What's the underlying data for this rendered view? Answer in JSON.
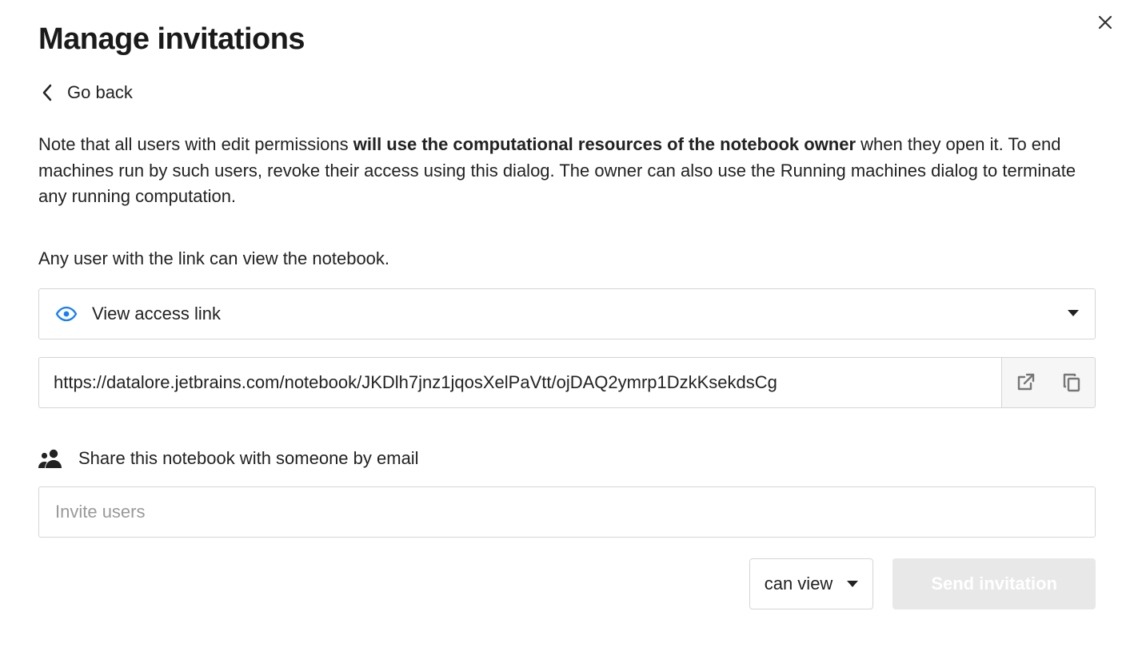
{
  "title": "Manage invitations",
  "go_back_label": "Go back",
  "note": {
    "prefix": "Note that all users with edit permissions ",
    "bold": "will use the computational resources of the notebook owner",
    "suffix": " when they open it. To end machines run by such users, revoke their access using this dialog. The owner can also use the Running machines dialog to terminate any running computation."
  },
  "link_info": "Any user with the link can view the notebook.",
  "access_dropdown": {
    "label": "View access link"
  },
  "share_url": "https://datalore.jetbrains.com/notebook/JKDlh7jnz1jqosXelPaVtt/ojDAQ2ymrp1DzkKsekdsCg",
  "share_heading": "Share this notebook with someone by email",
  "invite_placeholder": "Invite users",
  "permission_dropdown": {
    "label": "can view"
  },
  "send_button_label": "Send invitation"
}
